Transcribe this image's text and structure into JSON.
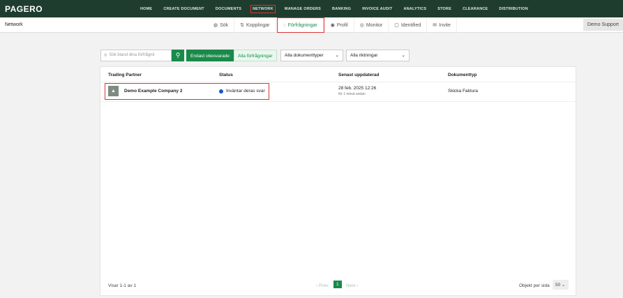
{
  "header": {
    "logo": "PAGERO",
    "nav": [
      "HOME",
      "CREATE DOCUMENT",
      "DOCUMENTS",
      "NETWORK",
      "MANAGE ORDERS",
      "BANKING",
      "INVOICE AUDIT",
      "ANALYTICS",
      "STORE",
      "CLEARANCE",
      "DISTRIBUTION"
    ],
    "active_nav": "NETWORK"
  },
  "subbar": {
    "title": "Network",
    "tabs": [
      {
        "icon": "globe-icon",
        "label": "Sök"
      },
      {
        "icon": "connections-icon",
        "label": "Kopplingar"
      },
      {
        "icon": "chat-icon",
        "label": "Förfrågningar"
      },
      {
        "icon": "profile-icon",
        "label": "Profil"
      },
      {
        "icon": "eye-icon",
        "label": "Monitor"
      },
      {
        "icon": "id-icon",
        "label": "Identified"
      },
      {
        "icon": "mail-icon",
        "label": "Invite"
      }
    ],
    "user": "Demo Support"
  },
  "filters": {
    "search_placeholder": "Sök bland dina förfrågnir",
    "toggle_on": "Endast obesvarade",
    "toggle_off": "Alla förfrågningar",
    "doc_types": "Alla dokumenttyper",
    "directions": "Alla riktningar"
  },
  "table": {
    "headers": [
      "Trading Partner",
      "Status",
      "Senast uppdaterad",
      "Dokumenttyp"
    ],
    "rows": [
      {
        "partner": "Demo Example Company 2",
        "status": "Inväntar deras svar",
        "updated": "28 feb. 2025 12:26",
        "updated_rel": "för 1 minut sedan",
        "doctype": "Skicka Faktura"
      }
    ]
  },
  "footer": {
    "showing": "Visar 1-1 av 1",
    "prev": "‹ Prev",
    "page": "1",
    "next": "Next ›",
    "per_page_label": "Objekt per sida",
    "per_page": "50"
  },
  "colors": {
    "brand": "#1f3d2e",
    "accent": "#1a8a4a",
    "highlight": "#dd3333"
  }
}
